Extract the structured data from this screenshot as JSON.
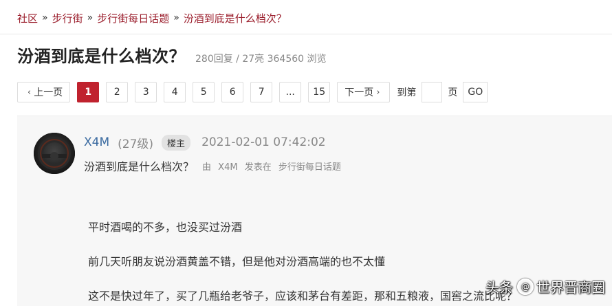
{
  "breadcrumb": {
    "items": [
      "社区",
      "步行街",
      "步行街每日话题",
      "汾酒到底是什么档次？"
    ],
    "sep": "»"
  },
  "thread": {
    "title": "汾酒到底是什么档次？",
    "stats": "280回复 / 27亮 364560 浏览"
  },
  "pager": {
    "prev": "上一页",
    "pages": [
      "1",
      "2",
      "3",
      "4",
      "5",
      "6",
      "7",
      "...",
      "15"
    ],
    "active_page": "1",
    "next": "下一页",
    "goto_label": "到第",
    "page_label": "页",
    "go": "GO"
  },
  "post": {
    "author": "X4M",
    "level": "(27级)",
    "badge": "楼主",
    "time": "2021-02-01 07:42:02",
    "subject": "汾酒到底是什么档次？",
    "meta_by": "由",
    "meta_author": "X4M",
    "meta_posted": "发表在",
    "meta_board": "步行街每日话题",
    "paragraphs": [
      "平时酒喝的不多，也没买过汾酒",
      "前几天听朋友说汾酒黄盖不错，但是他对汾酒高端的也不太懂",
      "这不是快过年了，买了几瓶给老爷子，应该和茅台有差距，那和五粮液，国窖之流比呢？"
    ]
  },
  "watermark": {
    "source": "头条",
    "account": "世界晋商圈"
  },
  "icons": {
    "prev": "chevron-left-icon",
    "next": "chevron-right-icon",
    "avatar": "avatar-image"
  },
  "colors": {
    "accent": "#c0222e",
    "link": "#9b1e2c",
    "author": "#3a6aa0"
  }
}
